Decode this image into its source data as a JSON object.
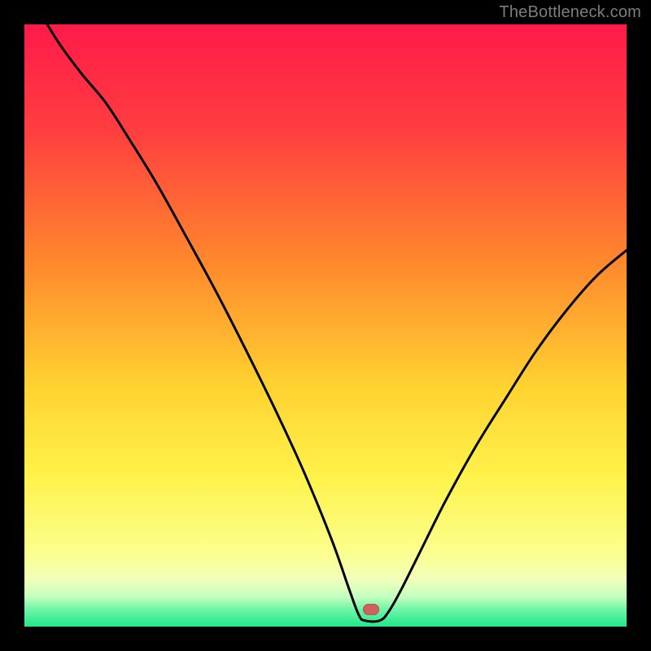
{
  "watermark": "TheBottleneck.com",
  "colors": {
    "frame": "#000000",
    "gradient_stops": [
      {
        "pct": 0,
        "color": "#ff1a4a"
      },
      {
        "pct": 18,
        "color": "#ff3f3f"
      },
      {
        "pct": 40,
        "color": "#ff8a2d"
      },
      {
        "pct": 60,
        "color": "#ffd231"
      },
      {
        "pct": 75,
        "color": "#fff24a"
      },
      {
        "pct": 88,
        "color": "#fbff8f"
      },
      {
        "pct": 92,
        "color": "#f2ffba"
      },
      {
        "pct": 95,
        "color": "#c6ffbf"
      },
      {
        "pct": 97,
        "color": "#74f5a8"
      },
      {
        "pct": 100,
        "color": "#1fe88a"
      }
    ],
    "curve": "#000000",
    "marker_fill": "#c9655e",
    "marker_stroke": "#b65650"
  },
  "marker": {
    "x_frac": 0.575,
    "y_frac": 0.972,
    "w": 20,
    "h": 14
  },
  "chart_data": {
    "type": "line",
    "title": "",
    "xlabel": "",
    "ylabel": "",
    "xlim": [
      0,
      1
    ],
    "ylim": [
      0,
      1
    ],
    "series": [
      {
        "name": "bottleneck-curve",
        "points": [
          {
            "x": 0.038,
            "y": 1.0
          },
          {
            "x": 0.06,
            "y": 0.965
          },
          {
            "x": 0.095,
            "y": 0.918
          },
          {
            "x": 0.135,
            "y": 0.87
          },
          {
            "x": 0.175,
            "y": 0.808
          },
          {
            "x": 0.22,
            "y": 0.735
          },
          {
            "x": 0.27,
            "y": 0.645
          },
          {
            "x": 0.32,
            "y": 0.553
          },
          {
            "x": 0.37,
            "y": 0.455
          },
          {
            "x": 0.42,
            "y": 0.353
          },
          {
            "x": 0.465,
            "y": 0.255
          },
          {
            "x": 0.51,
            "y": 0.145
          },
          {
            "x": 0.54,
            "y": 0.06
          },
          {
            "x": 0.555,
            "y": 0.02
          },
          {
            "x": 0.565,
            "y": 0.01
          },
          {
            "x": 0.59,
            "y": 0.01
          },
          {
            "x": 0.605,
            "y": 0.025
          },
          {
            "x": 0.625,
            "y": 0.06
          },
          {
            "x": 0.66,
            "y": 0.13
          },
          {
            "x": 0.7,
            "y": 0.21
          },
          {
            "x": 0.75,
            "y": 0.3
          },
          {
            "x": 0.8,
            "y": 0.38
          },
          {
            "x": 0.85,
            "y": 0.458
          },
          {
            "x": 0.9,
            "y": 0.525
          },
          {
            "x": 0.95,
            "y": 0.582
          },
          {
            "x": 1.0,
            "y": 0.625
          }
        ]
      }
    ],
    "marker_point": {
      "x": 0.575,
      "y": 0.028
    }
  }
}
